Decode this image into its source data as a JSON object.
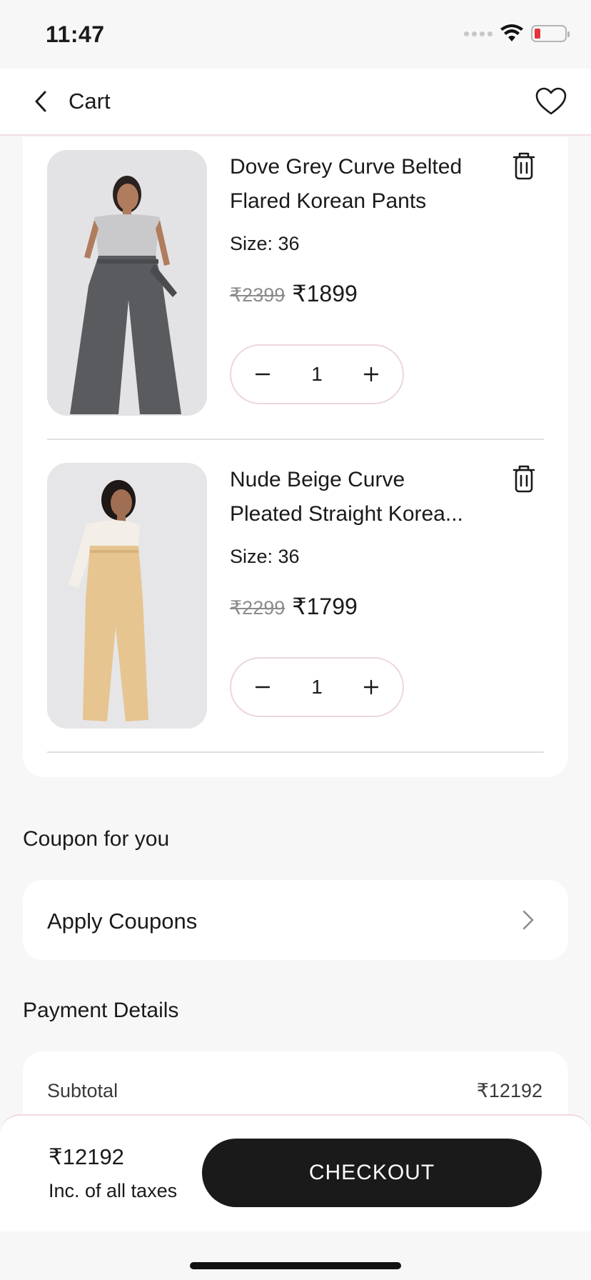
{
  "status_bar": {
    "time": "11:47",
    "icons": [
      "signal-icon",
      "wifi-icon",
      "battery-icon"
    ],
    "battery_color": "#e5333a"
  },
  "header": {
    "title": "Cart",
    "back_icon": "chevron-left-icon",
    "wishlist_icon": "heart-icon"
  },
  "cart": {
    "items": [
      {
        "name": "Dove Grey Curve Belted Flared Korean Pants",
        "size": "Size: 36",
        "mrp": "₹2399",
        "price": "₹1899",
        "quantity": "1",
        "delete_icon": "trash-icon"
      },
      {
        "name": "Nude Beige Curve Pleated Straight Korean Pants",
        "name_line1": "Nude Beige Curve",
        "name_line2": "Pleated Straight Korea...",
        "size": "Size: 36",
        "mrp": "₹2299",
        "price": "₹1799",
        "quantity": "1",
        "delete_icon": "trash-icon"
      }
    ],
    "decrement_icon": "minus-icon",
    "increment_icon": "plus-icon"
  },
  "coupon": {
    "section_title": "Coupon for you",
    "label": "Apply Coupons",
    "chevron_icon": "chevron-right-icon"
  },
  "payment": {
    "section_title": "Payment Details",
    "subtotal_label": "Subtotal",
    "subtotal_value": "₹12192"
  },
  "bottom_bar": {
    "total": "₹12192",
    "note": "Inc. of all taxes",
    "checkout_label": "CHECKOUT"
  },
  "colors": {
    "accent_border": "#ecd6de",
    "checkout_bg": "#1a1a1a",
    "page_bg": "#f7f7f7"
  }
}
